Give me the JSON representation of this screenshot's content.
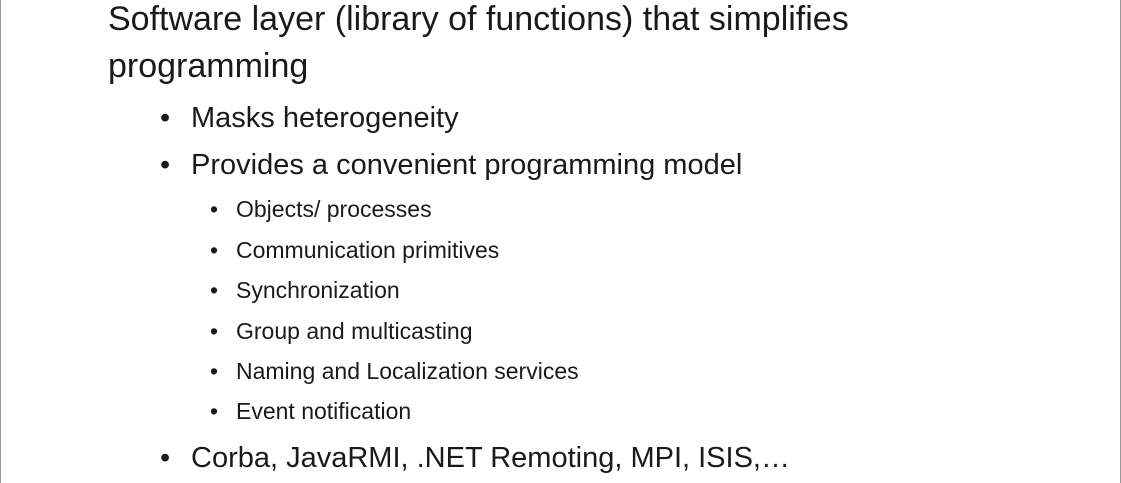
{
  "heading": "Software layer (library of functions) that simplifies programming",
  "bullet_glyph": "•",
  "bullets": [
    {
      "text": "Masks heterogeneity"
    },
    {
      "text": "Provides a convenient programming model"
    },
    {
      "text": "Objects/ processes"
    },
    {
      "text": "Communication primitives"
    },
    {
      "text": "Synchronization"
    },
    {
      "text": "Group and multicasting"
    },
    {
      "text": "Naming and Localization services"
    },
    {
      "text": "Event notification"
    },
    {
      "text": "Corba, JavaRMI, .NET Remoting, MPI, ISIS,…"
    }
  ]
}
